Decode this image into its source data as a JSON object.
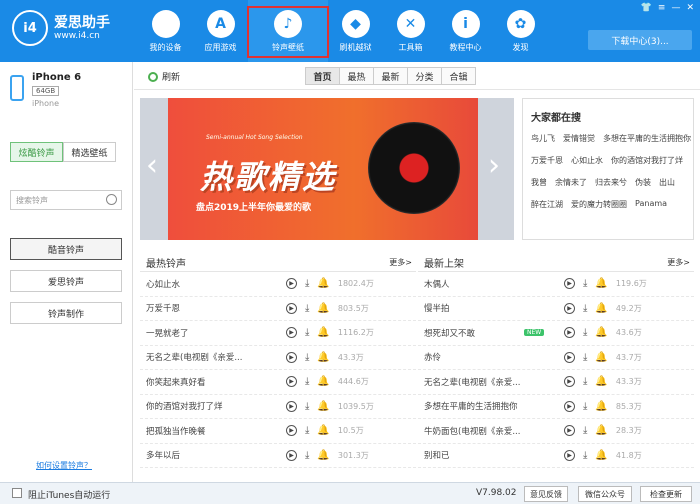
{
  "brand": {
    "mark": "i4",
    "name": "爱思助手",
    "url": "www.i4.cn"
  },
  "nav": [
    {
      "icon": "apple-icon",
      "glyph": "",
      "label": "我的设备"
    },
    {
      "icon": "app-store-icon",
      "glyph": "A",
      "label": "应用游戏"
    },
    {
      "icon": "ringtone-wallpaper-icon",
      "glyph": "♪",
      "label": "铃声壁纸"
    },
    {
      "icon": "dropbox-icon",
      "glyph": "◆",
      "label": "刷机越狱"
    },
    {
      "icon": "tools-icon",
      "glyph": "✕",
      "label": "工具箱"
    },
    {
      "icon": "info-icon",
      "glyph": "i",
      "label": "教程中心"
    },
    {
      "icon": "discover-icon",
      "glyph": "✿",
      "label": "发现"
    }
  ],
  "download_center": "下载中心(3)...",
  "device": {
    "name": "iPhone 6",
    "capacity": "64GB",
    "model": "iPhone"
  },
  "sidebar": {
    "tab_active": "炫酷铃声",
    "tab_other": "精选壁纸",
    "search_placeholder": "搜索铃声",
    "items": [
      "酷音铃声",
      "爱思铃声",
      "铃声制作"
    ],
    "help": "如何设置铃声？"
  },
  "toolbar": {
    "refresh": "刷新",
    "tabs": [
      "首页",
      "最热",
      "最新",
      "分类",
      "合辑"
    ]
  },
  "banner": {
    "subtitle": "Semi-annual Hot Song Selection",
    "title": "热歌精选",
    "caption": "盘点2019上半年你最爱的歌"
  },
  "hot_search": {
    "title": "大家都在搜",
    "words": [
      "鸟儿飞",
      "爱情错觉",
      "多想在平庸的生活拥抱你",
      "万爱千恩",
      "心如止水",
      "你的酒馆对我打了烊",
      "我曾",
      "余情未了",
      "归去来兮",
      "伪装",
      "出山",
      "醉在江湖",
      "爱的魔力转圈圈",
      "Panama"
    ]
  },
  "latest_ringtones": {
    "title": "最热铃声",
    "more": "更多>",
    "rows": [
      {
        "name": "心如止水",
        "count": "1802.4万"
      },
      {
        "name": "万爱千恩",
        "count": "803.5万"
      },
      {
        "name": "一晃就老了",
        "count": "1116.2万"
      },
      {
        "name": "无名之辈(电视剧《亲爱...",
        "count": "43.3万"
      },
      {
        "name": "你笑起来真好看",
        "count": "444.6万"
      },
      {
        "name": "你的酒馆对我打了烊",
        "count": "1039.5万"
      },
      {
        "name": "把孤独当作晚餐",
        "count": "10.5万"
      },
      {
        "name": "多年以后",
        "count": "301.3万"
      }
    ]
  },
  "new_ringtones": {
    "title": "最新上架",
    "more": "更多>",
    "badge": "NEW",
    "rows": [
      {
        "name": "木偶人",
        "count": "119.6万"
      },
      {
        "name": "慢半拍",
        "count": "49.2万"
      },
      {
        "name": "想死却又不敢",
        "count": "43.6万"
      },
      {
        "name": "赤伶",
        "count": "43.7万"
      },
      {
        "name": "无名之辈(电视剧《亲爱...",
        "count": "43.3万"
      },
      {
        "name": "多想在平庸的生活拥抱你",
        "count": "85.3万"
      },
      {
        "name": "牛奶面包(电视剧《亲爱...",
        "count": "28.3万"
      },
      {
        "name": "别和已",
        "count": "41.8万"
      }
    ]
  },
  "status": {
    "itunes": "阻止iTunes自动运行",
    "version": "V7.98.02",
    "feedback": "意见反馈",
    "wechat": "微信公众号",
    "update": "检查更新"
  }
}
